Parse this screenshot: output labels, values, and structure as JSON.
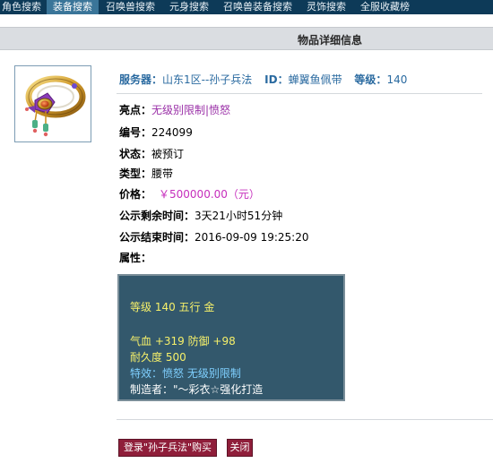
{
  "nav": {
    "tabs": [
      "角色搜索",
      "装备搜索",
      "召唤兽搜索",
      "元身搜索",
      "召唤兽装备搜索",
      "灵饰搜索",
      "全服收藏榜"
    ],
    "active_index": 1
  },
  "page": {
    "title": "物品详细信息"
  },
  "item": {
    "image_icon": "jade-gold-belt-icon",
    "server_label": "服务器：",
    "server_value": "山东1区--孙子兵法",
    "id_label": "ID：",
    "id_value": "蝉翼鱼佩带",
    "level_label": "等级：",
    "level_value": "140",
    "highlight_label": "亮点：",
    "highlight_value": "无级别限制|愤怒",
    "serial_label": "编号：",
    "serial_value": "224099",
    "status_label": "状态：",
    "status_value": "被预订",
    "type_label": "类型：",
    "type_value": "腰带",
    "price_label": "价格：",
    "price_value": "￥500000.00（元）",
    "remaining_label": "公示剩余时间：",
    "remaining_value": "3天21小时51分钟",
    "end_label": "公示结束时间：",
    "end_value": "2016-09-09 19:25:20",
    "attr_label": "属性："
  },
  "attributes": {
    "level_line": "等级 140 五行 金",
    "stats_line": "气血 +319 防御 +98",
    "durability_line": "耐久度 500",
    "special_line": "特效：愤怒 无级别限制",
    "maker_line": "制造者：\"～彩衣☆强化打造"
  },
  "buttons": {
    "buy_label": "登录\"孙子兵法\"购买",
    "close_label": "关闭"
  },
  "colors": {
    "nav_bg": "#0d3a58",
    "info_blue": "#2a6aa0",
    "highlight_purple": "#9a2fa7",
    "price_magenta": "#c62ebc",
    "attr_box_bg": "#33586c",
    "button_bg": "#8f1e3a"
  }
}
